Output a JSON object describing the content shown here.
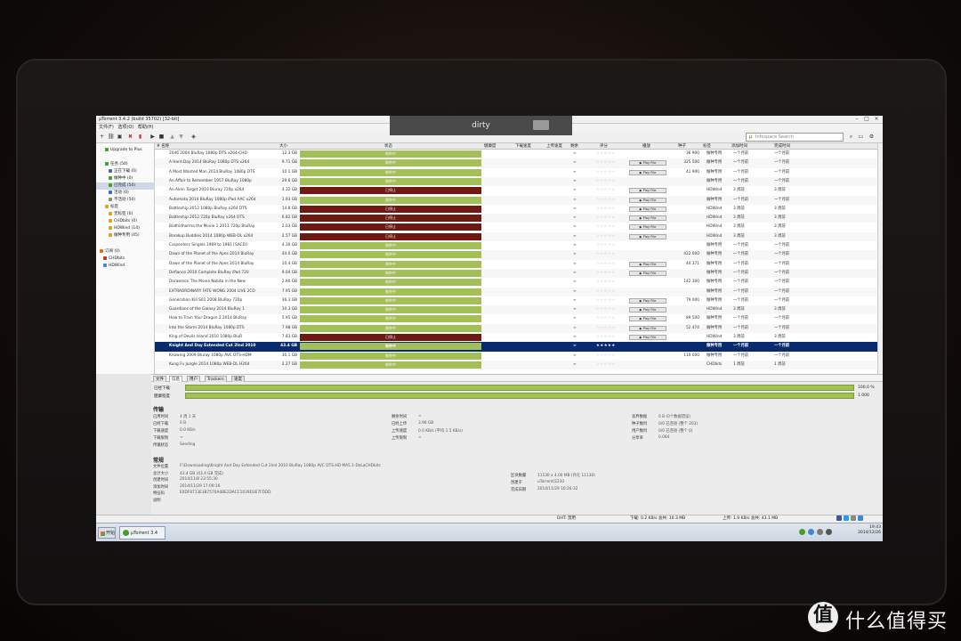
{
  "app_title": "µTorrent 3.4.2 (build 35702) [32-bit]",
  "popup": {
    "label": "dirty"
  },
  "menu": [
    "文件(F)",
    "选项(O)",
    "帮助(H)"
  ],
  "search": {
    "placeholder": "Infospace Search"
  },
  "sidebar": {
    "items": [
      {
        "label": "Upgrade to Plus",
        "color": "#4a9b2e"
      },
      {
        "label": "任务 (50)",
        "color": "#4a9b2e"
      },
      {
        "label": "正在下载 (0)",
        "color": "#3b6fb5"
      },
      {
        "label": "做种中 (0)",
        "color": "#4a9b2e"
      },
      {
        "label": "已完成 (50)",
        "color": "#4a9b2e"
      },
      {
        "label": "活动 (0)",
        "color": "#3b6fb5"
      },
      {
        "label": "不活动 (50)",
        "color": "#888888"
      },
      {
        "label": "标签",
        "color": "#d9a520"
      },
      {
        "label": "无标签 (0)",
        "color": "#d9a520"
      },
      {
        "label": "CHDbits (0)",
        "color": "#d9a520"
      },
      {
        "label": "HDWind (14)",
        "color": "#d9a520"
      },
      {
        "label": "做种专用 (45)",
        "color": "#d9a520"
      },
      {
        "label": "订阅 (0)",
        "color": "#e07020"
      },
      {
        "label": "CHDbits",
        "color": "#c83030"
      },
      {
        "label": "HDWind",
        "color": "#3b8ad8"
      }
    ]
  },
  "columns": {
    "name": "# 名称",
    "size": "大小",
    "status": "状态",
    "health": "健康度",
    "down_speed": "下载速度",
    "up_speed": "上传速度",
    "eta": "剩余",
    "rating": "评分",
    "play": "播放",
    "seeds": "种子",
    "label": "标签",
    "added": "添加时间",
    "completed": "完成时间"
  },
  "torrents": [
    {
      "name": "2046 2004 BluRay 1080p DTS x264-CHD",
      "size": "12.3 GB",
      "status": "做种中",
      "stopped": false,
      "eta": "∞",
      "rating": "☆☆☆☆☆",
      "play": "",
      "seeds": "36 900",
      "label": "做种专用",
      "added": "一个月前",
      "completed": "一个月前"
    },
    {
      "name": "A Hard Day 2014 BluRay 1080p DTS x264",
      "size": "9.71 GB",
      "status": "做种中",
      "stopped": false,
      "eta": "∞",
      "rating": "☆☆☆☆☆",
      "play": "▶ Play File",
      "seeds": "325 500",
      "label": "做种专用",
      "added": "一个月前",
      "completed": "一个月前"
    },
    {
      "name": "A Most Wanted Man 2014 BluRay 1080p DTS",
      "size": "10.1 GB",
      "status": "做种中",
      "stopped": false,
      "eta": "∞",
      "rating": "☆☆☆☆☆",
      "play": "▶ Play File",
      "seeds": "41 900",
      "label": "做种专用",
      "added": "一个月前",
      "completed": "一个月前"
    },
    {
      "name": "An Affair to Remember 1957 BluRay 1080p",
      "size": "29.6 GB",
      "status": "做种中",
      "stopped": false,
      "eta": "∞",
      "rating": "☆☆☆☆☆",
      "play": "",
      "seeds": "",
      "label": "做种专用",
      "added": "一个月前",
      "completed": "一个月前"
    },
    {
      "name": "An Alien Target 2010 Bluray 720p x264",
      "size": "4.32 GB",
      "status": "已停止",
      "stopped": true,
      "eta": "∞",
      "rating": "☆☆☆☆☆",
      "play": "▶ Play File",
      "seeds": "",
      "label": "HDWind",
      "added": "3 周前",
      "completed": "3 周前"
    },
    {
      "name": "Automata 2014 BluRay 1080p iPad AAC x264",
      "size": "1.93 GB",
      "status": "做种中",
      "stopped": false,
      "eta": "∞",
      "rating": "☆☆☆☆☆",
      "play": "▶ Play File",
      "seeds": "",
      "label": "做种专用",
      "added": "一个月前",
      "completed": "一个月前"
    },
    {
      "name": "Battleship 2012 1080p BluRay x264 DTS",
      "size": "14.8 GB",
      "status": "已停止",
      "stopped": true,
      "eta": "∞",
      "rating": "☆☆☆☆☆",
      "play": "▶ Play File",
      "seeds": "",
      "label": "HDWind",
      "added": "3 周前",
      "completed": "3 周前"
    },
    {
      "name": "Battleship 2012 720p BluRay x264 DTS",
      "size": "6.82 GB",
      "status": "已停止",
      "stopped": true,
      "eta": "∞",
      "rating": "☆☆☆☆☆",
      "play": "▶ Play File",
      "seeds": "",
      "label": "HDWind",
      "added": "3 周前",
      "completed": "3 周前"
    },
    {
      "name": "Bodhidharma the Movie 1 2011 720p BluRay",
      "size": "2.03 GB",
      "status": "已停止",
      "stopped": true,
      "eta": "∞",
      "rating": "☆☆☆☆☆",
      "play": "▶ Play File",
      "seeds": "",
      "label": "HDWind",
      "added": "3 周前",
      "completed": "3 周前"
    },
    {
      "name": "Breakup Buddies 2014 1080p WEB-DL x264",
      "size": "2.57 GB",
      "status": "已停止",
      "stopped": true,
      "eta": "∞",
      "rating": "☆☆☆☆☆",
      "play": "▶ Play File",
      "seeds": "",
      "label": "HDWind",
      "added": "3 周前",
      "completed": "3 周前"
    },
    {
      "name": "Carpenters Singles 1969 to 1981 [SACD]",
      "size": "4.30 GB",
      "status": "做种中",
      "stopped": false,
      "eta": "∞",
      "rating": "☆☆☆☆☆",
      "play": "",
      "seeds": "",
      "label": "做种专用",
      "added": "一个月前",
      "completed": "一个月前"
    },
    {
      "name": "Dawn of the Planet of the Apes 2014 BluRay",
      "size": "44.0 GB",
      "status": "做种中",
      "stopped": false,
      "eta": "∞",
      "rating": "☆☆☆☆☆",
      "play": "",
      "seeds": "422 000",
      "label": "做种专用",
      "added": "一个月前",
      "completed": "一个月前"
    },
    {
      "name": "Dawn of the Planet of the Apes 2014 BluRay",
      "size": "10.4 GB",
      "status": "做种中",
      "stopped": false,
      "eta": "∞",
      "rating": "☆☆☆☆☆",
      "play": "▶ Play File",
      "seeds": "44 371",
      "label": "做种专用",
      "added": "一个月前",
      "completed": "一个月前"
    },
    {
      "name": "Defiance 2010 Complete BluRay iPad 720",
      "size": "9.04 GB",
      "status": "做种中",
      "stopped": false,
      "eta": "∞",
      "rating": "☆☆☆☆☆",
      "play": "▶ Play File",
      "seeds": "",
      "label": "做种专用",
      "added": "一个月前",
      "completed": "一个月前"
    },
    {
      "name": "Doraemon The Movie Nobita in the New",
      "size": "2.90 GB",
      "status": "做种中",
      "stopped": false,
      "eta": "∞",
      "rating": "☆☆☆☆☆",
      "play": "",
      "seeds": "142 300",
      "label": "做种专用",
      "added": "一个月前",
      "completed": "一个月前"
    },
    {
      "name": "EXTRAORDINARY FATE WONG 2004 LIVE 2CD",
      "size": "7.95 GB",
      "status": "做种中",
      "stopped": false,
      "eta": "∞",
      "rating": "☆☆☆☆☆",
      "play": "",
      "seeds": "",
      "label": "做种专用",
      "added": "一个月前",
      "completed": "一个月前"
    },
    {
      "name": "Generation Kill S01 2008 BluRay 720p",
      "size": "36.3 GB",
      "status": "做种中",
      "stopped": false,
      "eta": "∞",
      "rating": "☆☆☆☆☆",
      "play": "▶ Play File",
      "seeds": "79 000",
      "label": "做种专用",
      "added": "一个月前",
      "completed": "一个月前"
    },
    {
      "name": "Guardians of the Galaxy 2014 BluRay 1",
      "size": "10.3 GB",
      "status": "做种中",
      "stopped": false,
      "eta": "∞",
      "rating": "☆☆☆☆☆",
      "play": "▶ Play File",
      "seeds": "",
      "label": "HDWind",
      "added": "3 周前",
      "completed": "3 周前"
    },
    {
      "name": "How to Train Your Dragon 2 2014 BluRay",
      "size": "5.95 GB",
      "status": "做种中",
      "stopped": false,
      "eta": "∞",
      "rating": "☆☆☆☆☆",
      "play": "▶ Play File",
      "seeds": "89 500",
      "label": "做种专用",
      "added": "一个月前",
      "completed": "一个月前"
    },
    {
      "name": "Into the Storm 2014 BluRay 1080p DTS",
      "size": "7.98 GB",
      "status": "做种中",
      "stopped": false,
      "eta": "∞",
      "rating": "☆☆☆☆☆",
      "play": "▶ Play File",
      "seeds": "52 474",
      "label": "做种专用",
      "added": "一个月前",
      "completed": "一个月前"
    },
    {
      "name": "King of Devils Island 2010 1080p BluR",
      "size": "7.83 GB",
      "status": "已停止",
      "stopped": true,
      "eta": "∞",
      "rating": "☆☆☆☆☆",
      "play": "▶ Play File",
      "seeds": "",
      "label": "HDWind",
      "added": "3 周前",
      "completed": "3 周前"
    },
    {
      "name": "Knight And Day Extended Cut 2Ind 2010",
      "size": "43.4 GB",
      "status": "做种中",
      "stopped": false,
      "selected": true,
      "eta": "∞",
      "rating": "★★★★★",
      "play": "",
      "seeds": "",
      "label": "做种专用",
      "added": "一个月前",
      "completed": "一个月前"
    },
    {
      "name": "Knowing 2009 Bluray 1080p AVC DTS-HDM",
      "size": "30.1 GB",
      "status": "做种中",
      "stopped": false,
      "eta": "∞",
      "rating": "☆☆☆☆☆",
      "play": "",
      "seeds": "110 000",
      "label": "做种专用",
      "added": "一个月前",
      "completed": "一个月前"
    },
    {
      "name": "Kung Fu Jungle 2014 1080p WEB-DL H264",
      "size": "2.27 GB",
      "status": "做种中",
      "stopped": false,
      "eta": "∞",
      "rating": "☆☆☆☆☆",
      "play": "",
      "seeds": "",
      "label": "CHDbits",
      "added": "1 周前",
      "completed": "1 周前"
    }
  ],
  "detail_tabs": [
    "文件",
    "信息",
    "用户",
    "Trackers",
    "速度"
  ],
  "progress": {
    "downloaded_label": "已经下载",
    "downloaded_value": "100.0 %",
    "downloaded_fraction": 1.0,
    "availability_label": "健康程度",
    "availability_value": "1.000",
    "availability_fraction": 1.0
  },
  "transfer": {
    "title": "传输",
    "left": [
      {
        "k": "已用时间",
        "v": "4 周 1 天"
      },
      {
        "k": "已经下载",
        "v": "0 B"
      },
      {
        "k": "下载速度",
        "v": "0.0 KB/s"
      },
      {
        "k": "下载限制",
        "v": "∞"
      },
      {
        "k": "传输状态",
        "v": "Seeding"
      }
    ],
    "mid": [
      {
        "k": "剩余时间",
        "v": "∞"
      },
      {
        "k": "已经上传",
        "v": "3.96 GB"
      },
      {
        "k": "上传速度",
        "v": "0.0 KB/s (平均 1.5 KB/s)"
      },
      {
        "k": "上传限制",
        "v": "∞"
      }
    ],
    "right": [
      {
        "k": "丢弃数据",
        "v": "0 B (0个数据错误)"
      },
      {
        "k": "种子数目",
        "v": "0/0 已连接 (整个 203)"
      },
      {
        "k": "用户数目",
        "v": "0/0 已连接 (整个 0)"
      },
      {
        "k": "分享率",
        "v": "0.084"
      }
    ]
  },
  "general": {
    "title": "常规",
    "left": [
      {
        "k": "文件位置",
        "v": "F:\\Downloading\\Knight And Day Extended Cut 2Ind 2010 BluRay 1080p AVC DTS-HD MA5.1-DoLaCHDbits"
      },
      {
        "k": "总计大小",
        "v": "43.4 GB (43.4 GB 完成)"
      },
      {
        "k": "创建时间",
        "v": "2014/11/8 23:55:30"
      },
      {
        "k": "添加时间",
        "v": "2014/11/29 17:09:16"
      },
      {
        "k": "特征码",
        "v": "E0DF8713E3B7570A4BE2DACC1039D3E7FDDD"
      },
      {
        "k": "说明",
        "v": ""
      }
    ],
    "right": [
      {
        "k": "区块数量",
        "v": "11130 x 4.00 MB (存在 11130)"
      },
      {
        "k": "创建于",
        "v": "uTorrent/2210"
      },
      {
        "k": "完成日期",
        "v": "2014/11/29 16:26:32"
      }
    ]
  },
  "statusbar": {
    "dht": "DHT: 禁用",
    "download": "下载: 0.2 KB/s 总共: 10.3 MB",
    "upload": "上传: 1.9 KB/s 总共: 43.1 MB"
  },
  "taskbar": {
    "start": "开始",
    "task": "µTorrent 3.4",
    "time": "19:43",
    "date": "2014/12/26"
  },
  "watermark": {
    "icon": "值",
    "text": "什么值得买"
  }
}
